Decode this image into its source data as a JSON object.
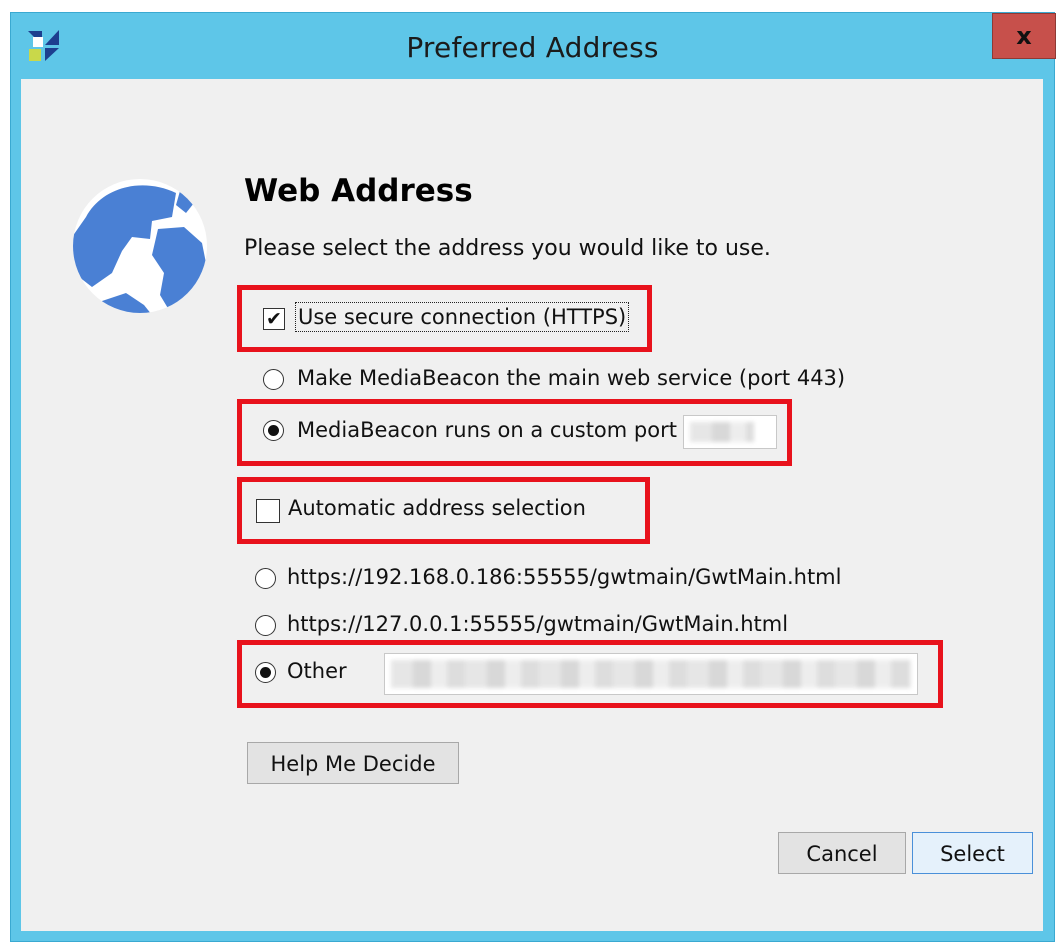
{
  "window": {
    "title": "Preferred Address",
    "close_glyph": "x",
    "app_icon": "mediabeacon-logo-icon",
    "titlebar_color": "#5ec6e8",
    "close_color": "#c7504b"
  },
  "header": {
    "icon": "globe-icon",
    "heading": "Web Address",
    "subtitle": "Please select the address you would like to use."
  },
  "options": {
    "secure_connection": {
      "label": "Use secure connection (HTTPS)",
      "checked": true
    },
    "port_main": {
      "label": "Make MediaBeacon the main web service (port 443)",
      "selected": false
    },
    "port_custom": {
      "label": "MediaBeacon runs on a custom port",
      "selected": true,
      "value": ""
    },
    "auto_select": {
      "label": "Automatic address selection",
      "checked": false
    },
    "address_1": {
      "label": "https://192.168.0.186:55555/gwtmain/GwtMain.html",
      "selected": false
    },
    "address_2": {
      "label": "https://127.0.0.1:55555/gwtmain/GwtMain.html",
      "selected": false
    },
    "address_other": {
      "label": "Other",
      "selected": true,
      "value": ""
    }
  },
  "buttons": {
    "help": "Help Me Decide",
    "cancel": "Cancel",
    "select": "Select"
  },
  "annotation_color": "#e8121c"
}
